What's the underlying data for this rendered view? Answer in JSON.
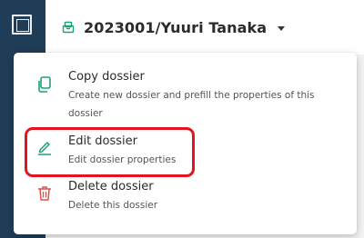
{
  "header": {
    "dossier_title": "2023001/Yuuri Tanaka"
  },
  "menu": {
    "items": [
      {
        "title": "Copy dossier",
        "description": "Create new dossier and prefill the properties of this dossier",
        "icon": "copy-icon"
      },
      {
        "title": "Edit dossier",
        "description": "Edit dossier properties",
        "icon": "pencil-icon"
      },
      {
        "title": "Delete dossier",
        "description": "Delete this dossier",
        "icon": "trash-icon"
      }
    ]
  },
  "colors": {
    "sidebar": "#1f3d57",
    "accent_green": "#1aa36f",
    "delete_red": "#e0504a",
    "highlight_red": "#e3131f"
  }
}
